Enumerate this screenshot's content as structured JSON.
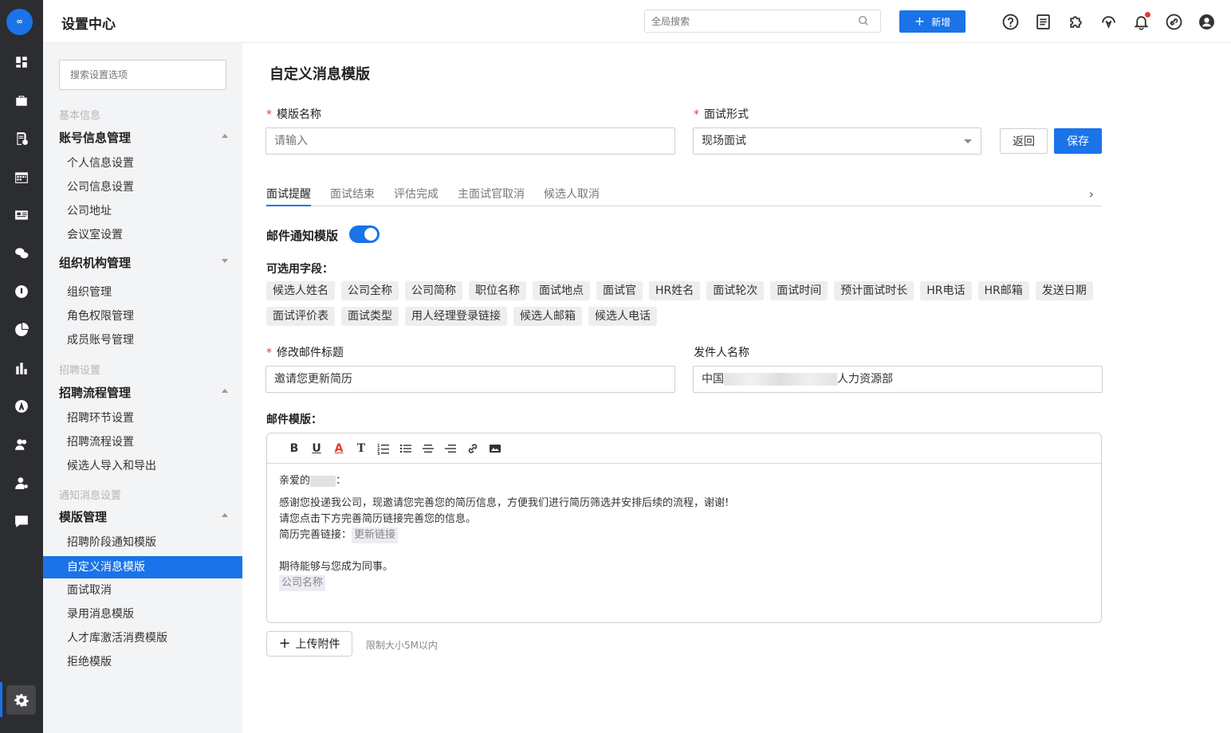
{
  "rail": {
    "logo_text": "∞",
    "icons": [
      "dashboard-icon",
      "briefcase-icon",
      "resume-icon",
      "calendar-icon",
      "id-card-icon",
      "wechat-icon",
      "talent-icon",
      "pie-chart-icon",
      "bar-chart-icon",
      "a-circle-icon",
      "people-icon",
      "team-icon",
      "chat-icon",
      "settings-icon"
    ]
  },
  "topbar": {
    "title": "设置中心",
    "search_placeholder": "全局搜索",
    "add_label": "新增",
    "icons": [
      "help-icon",
      "document-icon",
      "puzzle-icon",
      "headset-icon",
      "bell-icon",
      "link-icon",
      "user-avatar-icon"
    ],
    "accent": "#1a73e8",
    "notification_dot_color": "#e53935"
  },
  "sidebar": {
    "search_placeholder": "搜索设置选项",
    "group_basic": "基本信息",
    "sec_account": "账号信息管理",
    "account_items": [
      "个人信息设置",
      "公司信息设置",
      "公司地址",
      "会议室设置"
    ],
    "sec_org": "组织机构管理",
    "org_items": [
      "组织管理",
      "角色权限管理",
      "成员账号管理"
    ],
    "group_recruit": "招聘设置",
    "sec_process": "招聘流程管理",
    "process_items": [
      "招聘环节设置",
      "招聘流程设置",
      "候选人导入和导出"
    ],
    "group_notify": "通知消息设置",
    "sec_template": "模版管理",
    "template_items": [
      "招聘阶段通知模版",
      "自定义消息模版",
      "面试取消",
      "录用消息模版",
      "人才库激活消费模版",
      "拒绝模版"
    ],
    "active_item": "自定义消息模版"
  },
  "main": {
    "title": "自定义消息模版",
    "template_name_label": "模版名称",
    "template_name_placeholder": "请输入",
    "interview_type_label": "面试形式",
    "interview_type_value": "现场面试",
    "back_label": "返回",
    "save_label": "保存",
    "tabs": [
      "面试提醒",
      "面试结束",
      "评估完成",
      "主面试官取消",
      "候选人取消"
    ],
    "active_tab": "面试提醒",
    "email_toggle_label": "邮件通知模版",
    "email_toggle_on": true,
    "fields_label": "可选用字段：",
    "fields": [
      "候选人姓名",
      "公司全称",
      "公司简称",
      "职位名称",
      "面试地点",
      "面试官",
      "HR姓名",
      "面试轮次",
      "面试时间",
      "预计面试时长",
      "HR电话",
      "HR邮箱",
      "发送日期",
      "面试评价表",
      "面试类型",
      "用人经理登录链接",
      "候选人邮箱",
      "候选人电话"
    ],
    "subject_label": "修改邮件标题",
    "subject_value": "邀请您更新简历",
    "sender_label": "发件人名称",
    "sender_value_prefix": "中国",
    "sender_value_suffix": "人力资源部",
    "template_label": "邮件模版：",
    "email_body": {
      "greeting_prefix": "亲爱的",
      "greeting_suffix": "：",
      "line1": "感谢您投递我公司，现邀请您完善您的简历信息，方便我们进行简历筛选并安排后续的流程，谢谢!",
      "line2": "请您点击下方完善简历链接完善您的信息。",
      "link_prefix": "简历完善链接：",
      "link_tag": "更新链接",
      "closing": "期待能够与您成为同事。",
      "company_tag": "公司名称"
    },
    "upload_label": "上传附件",
    "upload_limit": "限制大小5M以内"
  }
}
